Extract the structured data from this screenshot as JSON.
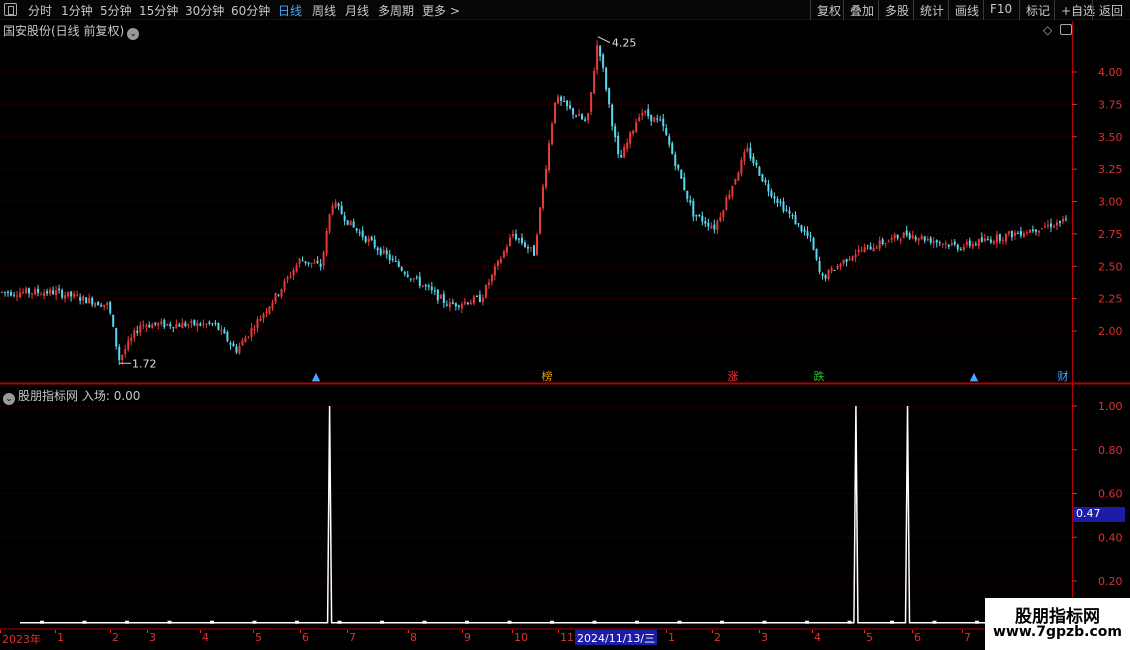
{
  "toolbar": {
    "periods": [
      "分时",
      "1分钟",
      "5分钟",
      "15分钟",
      "30分钟",
      "60分钟",
      "日线",
      "周线",
      "月线",
      "多周期",
      "更多 >"
    ],
    "active_period": "日线",
    "right_buttons": [
      "复权",
      "叠加",
      "多股",
      "统计",
      "画线",
      "F10",
      "标记",
      "+自选",
      "返回"
    ]
  },
  "main_panel": {
    "title": "国安股份(日线 前复权)",
    "high_label": "4.25",
    "low_label": "1.72",
    "price_ticks": [
      "4.00",
      "3.75",
      "3.50",
      "3.25",
      "3.00",
      "2.75",
      "2.50",
      "2.25",
      "2.00"
    ],
    "markers": [
      {
        "label": "榜",
        "color": "#e8a000"
      },
      {
        "label": "涨",
        "color": "#ff3030"
      },
      {
        "label": "跌",
        "color": "#30c030"
      },
      {
        "label": "财",
        "color": "#4aa6ff"
      }
    ],
    "up_color": "#e83a3a",
    "down_color": "#5ad8f0"
  },
  "indicator_panel": {
    "title": "股朋指标网",
    "series_label": "入场: 0.00",
    "value_ticks": [
      "1.00",
      "0.80",
      "0.60",
      "0.40",
      "0.20"
    ],
    "cursor_value": "0.47"
  },
  "date_axis": {
    "labels": [
      "2023年",
      "1",
      "2",
      "3",
      "4",
      "5",
      "6",
      "7",
      "8",
      "9",
      "10",
      "11",
      "1",
      "2",
      "3",
      "4",
      "5",
      "6",
      "7"
    ],
    "cursor_date": "2024/11/13/三"
  },
  "watermark": {
    "title": "股朋指标网",
    "url": "www.7gpzb.com"
  },
  "chart_data": {
    "type": "candlestick",
    "title": "国安股份(日线 前复权)",
    "y_range": [
      1.72,
      4.25
    ],
    "series_shape": [
      [
        0.0,
        2.3
      ],
      [
        0.05,
        2.3
      ],
      [
        0.1,
        2.2
      ],
      [
        0.11,
        1.78
      ],
      [
        0.13,
        2.05
      ],
      [
        0.2,
        2.05
      ],
      [
        0.22,
        1.85
      ],
      [
        0.26,
        2.3
      ],
      [
        0.28,
        2.55
      ],
      [
        0.3,
        2.5
      ],
      [
        0.31,
        3.0
      ],
      [
        0.33,
        2.8
      ],
      [
        0.38,
        2.45
      ],
      [
        0.42,
        2.2
      ],
      [
        0.45,
        2.25
      ],
      [
        0.48,
        2.75
      ],
      [
        0.5,
        2.6
      ],
      [
        0.52,
        3.8
      ],
      [
        0.55,
        3.6
      ],
      [
        0.56,
        4.25
      ],
      [
        0.58,
        3.3
      ],
      [
        0.6,
        3.7
      ],
      [
        0.62,
        3.6
      ],
      [
        0.65,
        2.9
      ],
      [
        0.67,
        2.8
      ],
      [
        0.7,
        3.4
      ],
      [
        0.72,
        3.1
      ],
      [
        0.76,
        2.7
      ],
      [
        0.77,
        2.4
      ],
      [
        0.8,
        2.6
      ],
      [
        0.85,
        2.75
      ],
      [
        0.9,
        2.65
      ],
      [
        0.95,
        2.75
      ],
      [
        1.0,
        2.85
      ]
    ],
    "indicator_spikes": [
      0.3,
      0.81,
      0.86
    ],
    "indicator_range": [
      0,
      1.0
    ]
  }
}
